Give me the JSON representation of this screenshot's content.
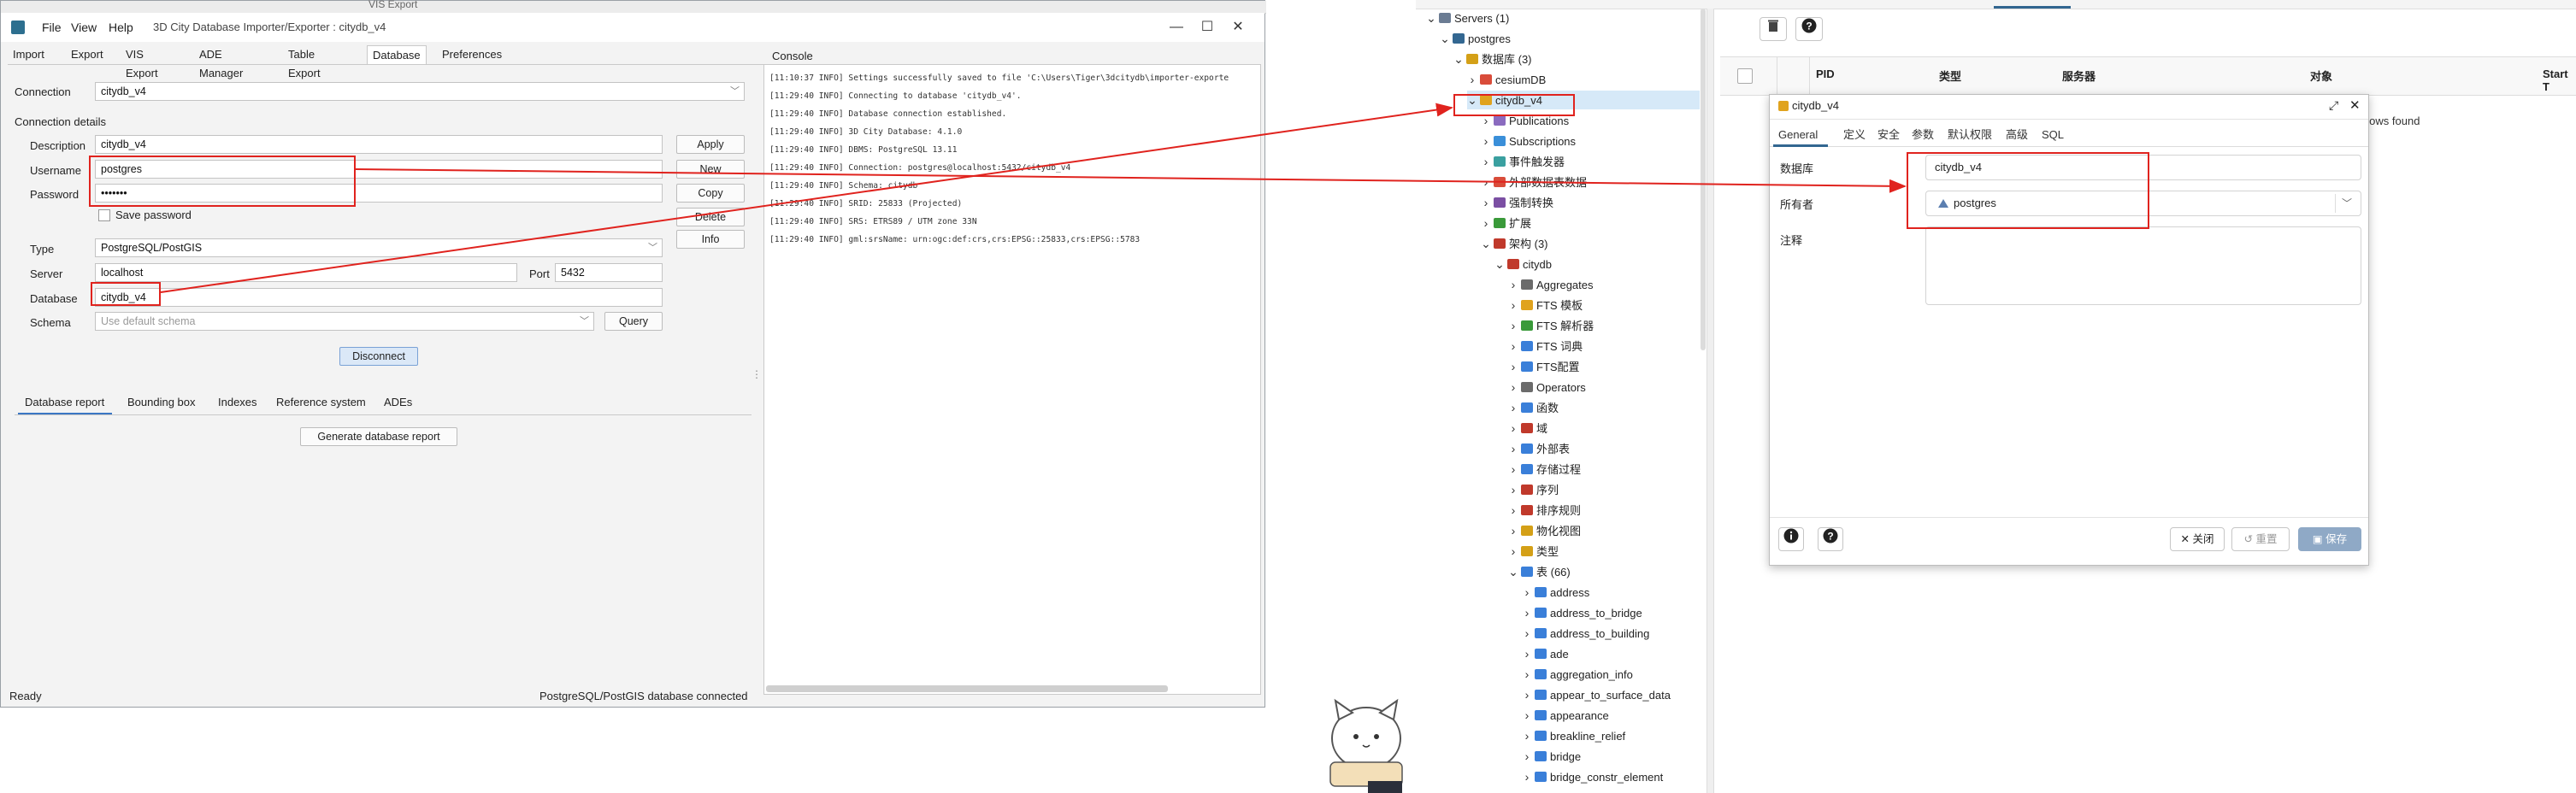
{
  "desktop": {
    "top_title": "VIS Export"
  },
  "importer": {
    "title": "3D City Database Importer/Exporter : citydb_v4",
    "menu": [
      "File",
      "View",
      "Help"
    ],
    "window_controls": {
      "minimize": "—",
      "maximize": "☐",
      "close": "✕"
    },
    "main_tabs": [
      "Import",
      "Export",
      "VIS Export",
      "ADE Manager",
      "Table Export",
      "Database",
      "Preferences"
    ],
    "active_tab": "Database",
    "connection": {
      "label": "Connection",
      "value": "citydb_v4"
    },
    "connection_details": {
      "heading": "Connection details",
      "description_label": "Description",
      "description": "citydb_v4",
      "username_label": "Username",
      "username": "postgres",
      "password_label": "Password",
      "password": "•••••••",
      "save_password": "Save password",
      "type_label": "Type",
      "type": "PostgreSQL/PostGIS",
      "server_label": "Server",
      "server": "localhost",
      "port_label": "Port",
      "port": "5432",
      "database_label": "Database",
      "database": "citydb_v4",
      "schema_label": "Schema",
      "schema_placeholder": "Use default schema"
    },
    "buttons": {
      "apply": "Apply",
      "new": "New",
      "copy": "Copy",
      "delete": "Delete",
      "info": "Info",
      "query": "Query",
      "disconnect": "Disconnect",
      "generate_report": "Generate database report"
    },
    "sub_tabs": [
      "Database report",
      "Bounding box",
      "Indexes",
      "Reference system",
      "ADEs"
    ],
    "console_title": "Console",
    "console_lines": [
      "[11:10:37 INFO] Settings successfully saved to file 'C:\\Users\\Tiger\\3dcitydb\\importer-exporte",
      "[11:29:40 INFO] Connecting to database 'citydb_v4'.",
      "[11:29:40 INFO] Database connection established.",
      "[11:29:40 INFO] 3D City Database: 4.1.0",
      "[11:29:40 INFO] DBMS: PostgreSQL 13.11",
      "[11:29:40 INFO] Connection: postgres@localhost:5432/citydb_v4",
      "[11:29:40 INFO] Schema: citydb",
      "[11:29:40 INFO] SRID: 25833 (Projected)",
      "[11:29:40 INFO] SRS: ETRS89 / UTM zone 33N",
      "[11:29:40 INFO] gml:srsName: urn:ogc:def:crs,crs:EPSG::25833,crs:EPSG::5783"
    ],
    "status_left": "Ready",
    "status_right": "PostgreSQL/PostGIS database connected"
  },
  "pgadmin": {
    "tree": [
      {
        "text": "Servers (1)",
        "icon": "servers-icon",
        "color": "#6b7c93"
      },
      {
        "text": "postgres",
        "icon": "server-icon",
        "color": "#336791"
      },
      {
        "text": "数据库 (3)",
        "icon": "databases-icon",
        "color": "#d4a017"
      },
      {
        "text": "cesiumDB",
        "icon": "database-icon",
        "color": "#d94c3a"
      },
      {
        "text": "citydb_v4",
        "icon": "database-icon",
        "color": "#e0a31e"
      },
      {
        "text": "Publications",
        "icon": "publications-icon",
        "color": "#8a6bbf"
      },
      {
        "text": "Subscriptions",
        "icon": "subscriptions-icon",
        "color": "#3a8fd9"
      },
      {
        "text": "事件触发器",
        "icon": "event-trigger-icon",
        "color": "#3aa0a0"
      },
      {
        "text": "外部数据表数据",
        "icon": "foreign-data-icon",
        "color": "#d94c3a"
      },
      {
        "text": "强制转换",
        "icon": "cast-icon",
        "color": "#7b4fa3"
      },
      {
        "text": "扩展",
        "icon": "extension-icon",
        "color": "#3a9a3a"
      },
      {
        "text": "架构 (3)",
        "icon": "schemas-icon",
        "color": "#c0392b"
      },
      {
        "text": "citydb",
        "icon": "schema-icon",
        "color": "#c0392b"
      },
      {
        "text": "Aggregates",
        "icon": "aggregates-icon",
        "color": "#6b6b6b"
      },
      {
        "text": "FTS 模板",
        "icon": "fts-template-icon",
        "color": "#e0a31e"
      },
      {
        "text": "FTS 解析器",
        "icon": "fts-parser-icon",
        "color": "#3a9a3a"
      },
      {
        "text": "FTS 词典",
        "icon": "fts-dictionary-icon",
        "color": "#3a7fd9"
      },
      {
        "text": "FTS配置",
        "icon": "fts-config-icon",
        "color": "#3a7fd9"
      },
      {
        "text": "Operators",
        "icon": "operators-icon",
        "color": "#6b6b6b"
      },
      {
        "text": "函数",
        "icon": "functions-icon",
        "color": "#3a7fd9"
      },
      {
        "text": "域",
        "icon": "domains-icon",
        "color": "#c0392b"
      },
      {
        "text": "外部表",
        "icon": "foreign-tables-icon",
        "color": "#3a7fd9"
      },
      {
        "text": "存储过程",
        "icon": "procedures-icon",
        "color": "#3a7fd9"
      },
      {
        "text": "序列",
        "icon": "sequences-icon",
        "color": "#c0392b"
      },
      {
        "text": "排序规则",
        "icon": "collations-icon",
        "color": "#c0392b"
      },
      {
        "text": "物化视图",
        "icon": "materialized-views-icon",
        "color": "#d4a017"
      },
      {
        "text": "类型",
        "icon": "types-icon",
        "color": "#d4a017"
      },
      {
        "text": "表 (66)",
        "icon": "tables-icon",
        "color": "#3a7fd9"
      },
      {
        "text": "address",
        "icon": "table-icon",
        "color": "#3a7fd9"
      },
      {
        "text": "address_to_bridge",
        "icon": "table-icon",
        "color": "#3a7fd9"
      },
      {
        "text": "address_to_building",
        "icon": "table-icon",
        "color": "#3a7fd9"
      },
      {
        "text": "ade",
        "icon": "table-icon",
        "color": "#3a7fd9"
      },
      {
        "text": "aggregation_info",
        "icon": "table-icon",
        "color": "#3a7fd9"
      },
      {
        "text": "appear_to_surface_data",
        "icon": "table-icon",
        "color": "#3a7fd9"
      },
      {
        "text": "appearance",
        "icon": "table-icon",
        "color": "#3a7fd9"
      },
      {
        "text": "breakline_relief",
        "icon": "table-icon",
        "color": "#3a7fd9"
      },
      {
        "text": "bridge",
        "icon": "table-icon",
        "color": "#3a7fd9"
      },
      {
        "text": "bridge_constr_element",
        "icon": "table-icon",
        "color": "#3a7fd9"
      }
    ],
    "grid_headers": [
      "PID",
      "类型",
      "服务器",
      "对象",
      "Start T"
    ],
    "no_rows": "o rows found",
    "dialog": {
      "title": "citydb_v4",
      "tabs": [
        "General",
        "定义",
        "安全",
        "参数",
        "默认权限",
        "高级",
        "SQL"
      ],
      "database_label": "数据库",
      "database_value": "citydb_v4",
      "owner_label": "所有者",
      "owner_value": "postgres",
      "comment_label": "注释",
      "close_label": "关闭",
      "reset_label": "重置",
      "save_label": "保存"
    }
  },
  "colors": {
    "annotation_red": "#e0231e",
    "pg_accent": "#326690",
    "selected_row": "#d6e9f8"
  }
}
